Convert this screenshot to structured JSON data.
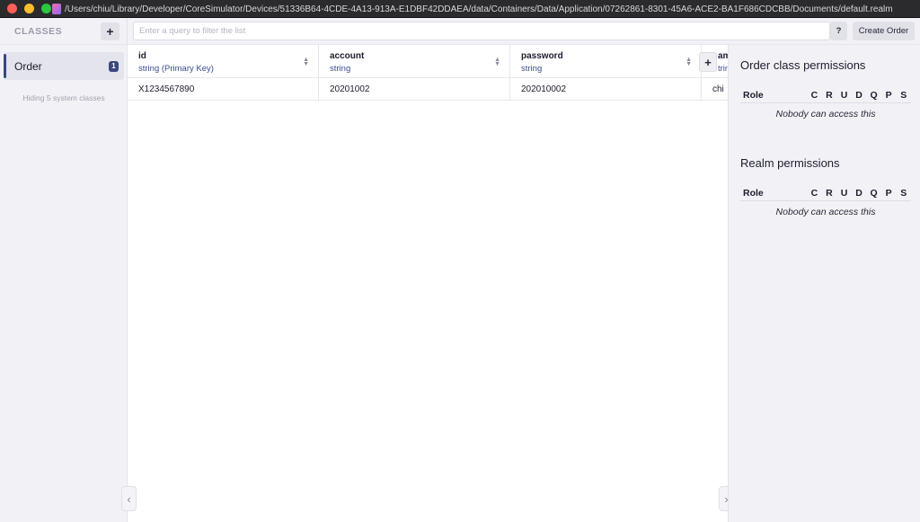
{
  "window": {
    "title": "/Users/chiu/Library/Developer/CoreSimulator/Devices/51336B64-4CDE-4A13-913A-E1DBF42DDAEA/data/Containers/Data/Application/07262861-8301-45A6-ACE2-BA1F686CDCBB/Documents/default.realm"
  },
  "sidebar": {
    "title": "CLASSES",
    "add_label": "+",
    "classes": [
      {
        "name": "Order",
        "count": "1"
      }
    ],
    "hidden_note": "Hiding 5 system classes",
    "collapse_label": "‹"
  },
  "query": {
    "placeholder": "Enter a query to filter the list",
    "value": "",
    "help_label": "?",
    "create_label": "Create Order"
  },
  "table": {
    "columns": [
      {
        "name": "id",
        "type": "string (Primary Key)"
      },
      {
        "name": "account",
        "type": "string"
      },
      {
        "name": "password",
        "type": "string"
      },
      {
        "name": "am",
        "type": "trin"
      }
    ],
    "rows": [
      [
        "X1234567890",
        "20201002",
        "202010002",
        "chi"
      ]
    ],
    "add_column_label": "+",
    "collapse_label": "›"
  },
  "permissions": {
    "flags": [
      "C",
      "R",
      "U",
      "D",
      "Q",
      "P",
      "S"
    ],
    "role_label": "Role",
    "sections": [
      {
        "title": "Order class permissions",
        "empty_text": "Nobody can access this"
      },
      {
        "title": "Realm permissions",
        "empty_text": "Nobody can access this"
      }
    ]
  },
  "colors": {
    "accent": "#39477f",
    "type_text": "#3a4d8f",
    "sidebar_bg": "#f2f2f6",
    "titlebar_bg": "#2b2b2d"
  }
}
